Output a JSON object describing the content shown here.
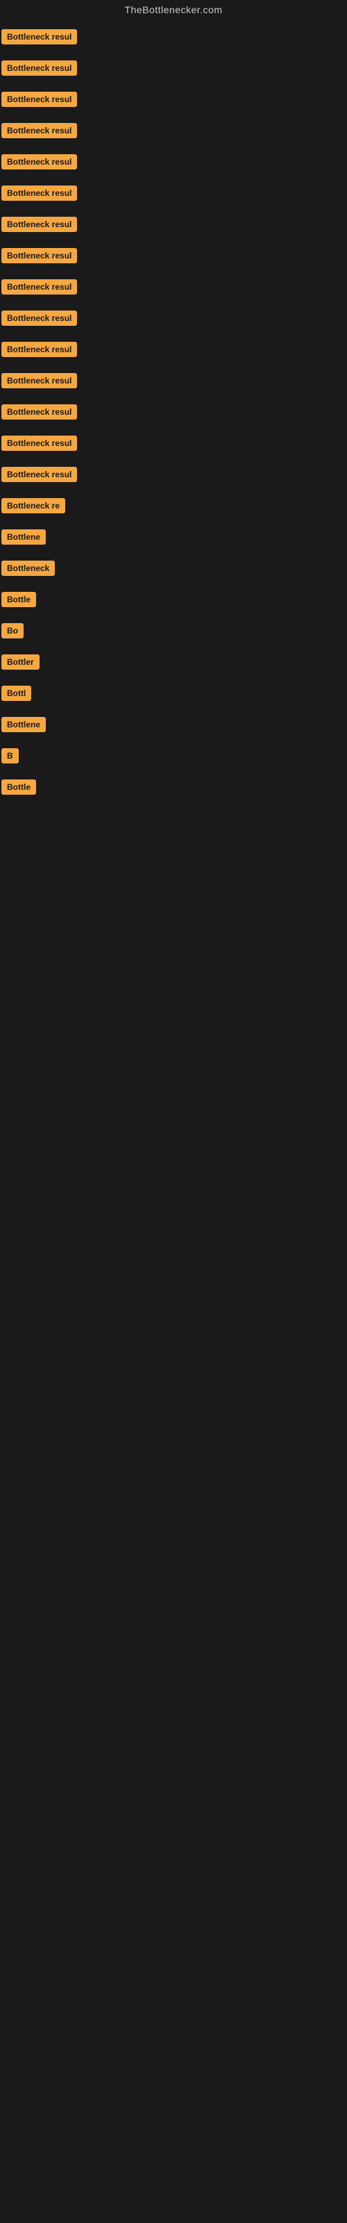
{
  "site": {
    "title": "TheBottlenecker.com"
  },
  "badges": [
    {
      "label": "Bottleneck result",
      "visible_chars": 16
    },
    {
      "label": "Bottleneck result",
      "visible_chars": 16
    },
    {
      "label": "Bottleneck result",
      "visible_chars": 16
    },
    {
      "label": "Bottleneck result",
      "visible_chars": 16
    },
    {
      "label": "Bottleneck result",
      "visible_chars": 16
    },
    {
      "label": "Bottleneck result",
      "visible_chars": 16
    },
    {
      "label": "Bottleneck result",
      "visible_chars": 16
    },
    {
      "label": "Bottleneck result",
      "visible_chars": 16
    },
    {
      "label": "Bottleneck result",
      "visible_chars": 16
    },
    {
      "label": "Bottleneck result",
      "visible_chars": 16
    },
    {
      "label": "Bottleneck result",
      "visible_chars": 16
    },
    {
      "label": "Bottleneck result",
      "visible_chars": 16
    },
    {
      "label": "Bottleneck result",
      "visible_chars": 16
    },
    {
      "label": "Bottleneck result",
      "visible_chars": 16
    },
    {
      "label": "Bottleneck result",
      "visible_chars": 16
    },
    {
      "label": "Bottleneck re",
      "visible_chars": 13
    },
    {
      "label": "Bottlene",
      "visible_chars": 8
    },
    {
      "label": "Bottleneck",
      "visible_chars": 10
    },
    {
      "label": "Bottle",
      "visible_chars": 6
    },
    {
      "label": "Bo",
      "visible_chars": 2
    },
    {
      "label": "Bottler",
      "visible_chars": 7
    },
    {
      "label": "Bottl",
      "visible_chars": 5
    },
    {
      "label": "Bottlene",
      "visible_chars": 8
    },
    {
      "label": "B",
      "visible_chars": 1
    },
    {
      "label": "Bottle",
      "visible_chars": 6
    }
  ]
}
